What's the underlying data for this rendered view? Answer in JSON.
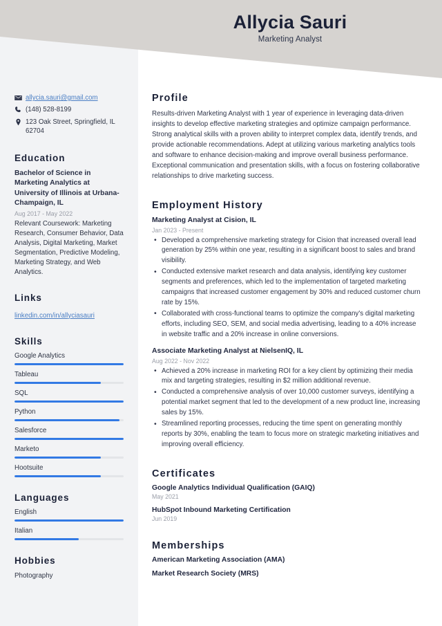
{
  "colors": {
    "header_band": "#d6d3d0",
    "sidebar": "#f2f3f5",
    "accent_bar": "#3279e4",
    "bar_track": "#e3e5e8",
    "heading": "#1b2137",
    "link": "#4a7ec4",
    "muted_date": "#9a9ea8"
  },
  "header": {
    "name": "Allycia Sauri",
    "job_title": "Marketing Analyst"
  },
  "sidebar": {
    "contact": [
      {
        "icon": "envelope-icon",
        "text": "allycia.sauri@gmail.com",
        "is_link": true
      },
      {
        "icon": "phone-icon",
        "text": "(148) 528-8199",
        "is_link": false
      },
      {
        "icon": "map-pin-icon",
        "text": "123 Oak Street, Springfield, IL 62704",
        "is_link": false
      }
    ],
    "education": {
      "heading": "Education",
      "entries": [
        {
          "title": "Bachelor of Science in Marketing Analytics at University of Illinois at Urbana-Champaign, IL",
          "date": "Aug 2017 - May 2022",
          "description": "Relevant Coursework: Marketing Research, Consumer Behavior, Data Analysis, Digital Marketing, Market Segmentation, Predictive Modeling, Marketing Strategy, and Web Analytics."
        }
      ]
    },
    "links": {
      "heading": "Links",
      "items": [
        {
          "label": "linkedin.com/in/allyciasauri"
        }
      ]
    },
    "skills": {
      "heading": "Skills",
      "items": [
        {
          "label": "Google Analytics",
          "level": 100
        },
        {
          "label": "Tableau",
          "level": 79
        },
        {
          "label": "SQL",
          "level": 100
        },
        {
          "label": "Python",
          "level": 96
        },
        {
          "label": "Salesforce",
          "level": 100
        },
        {
          "label": "Marketo",
          "level": 79
        },
        {
          "label": "Hootsuite",
          "level": 79
        }
      ]
    },
    "languages": {
      "heading": "Languages",
      "items": [
        {
          "label": "English",
          "level": 100
        },
        {
          "label": "Italian",
          "level": 59
        }
      ]
    },
    "hobbies": {
      "heading": "Hobbies",
      "items": [
        {
          "label": "Photography"
        }
      ]
    }
  },
  "main": {
    "profile": {
      "heading": "Profile",
      "text": "Results-driven Marketing Analyst with 1 year of experience in leveraging data-driven insights to develop effective marketing strategies and optimize campaign performance. Strong analytical skills with a proven ability to interpret complex data, identify trends, and provide actionable recommendations. Adept at utilizing various marketing analytics tools and software to enhance decision-making and improve overall business performance. Exceptional communication and presentation skills, with a focus on fostering collaborative relationships to drive marketing success."
    },
    "employment": {
      "heading": "Employment History",
      "jobs": [
        {
          "role": "Marketing Analyst at Cision, IL",
          "date": "Jan 2023 - Present",
          "bullets": [
            "Developed a comprehensive marketing strategy for Cision that increased overall lead generation by 25% within one year, resulting in a significant boost to sales and brand visibility.",
            "Conducted extensive market research and data analysis, identifying key customer segments and preferences, which led to the implementation of targeted marketing campaigns that increased customer engagement by 30% and reduced customer churn rate by 15%.",
            "Collaborated with cross-functional teams to optimize the company's digital marketing efforts, including SEO, SEM, and social media advertising, leading to a 40% increase in website traffic and a 20% increase in online conversions."
          ]
        },
        {
          "role": "Associate Marketing Analyst at NielsenIQ, IL",
          "date": "Aug 2022 - Nov 2022",
          "bullets": [
            "Achieved a 20% increase in marketing ROI for a key client by optimizing their media mix and targeting strategies, resulting in $2 million additional revenue.",
            "Conducted a comprehensive analysis of over 10,000 customer surveys, identifying a potential market segment that led to the development of a new product line, increasing sales by 15%.",
            "Streamlined reporting processes, reducing the time spent on generating monthly reports by 30%, enabling the team to focus more on strategic marketing initiatives and improving overall efficiency."
          ]
        }
      ]
    },
    "certificates": {
      "heading": "Certificates",
      "items": [
        {
          "title": "Google Analytics Individual Qualification (GAIQ)",
          "date": "May 2021"
        },
        {
          "title": "HubSpot Inbound Marketing Certification",
          "date": "Jun 2019"
        }
      ]
    },
    "memberships": {
      "heading": "Memberships",
      "items": [
        {
          "title": "American Marketing Association (AMA)"
        },
        {
          "title": "Market Research Society (MRS)"
        }
      ]
    }
  }
}
